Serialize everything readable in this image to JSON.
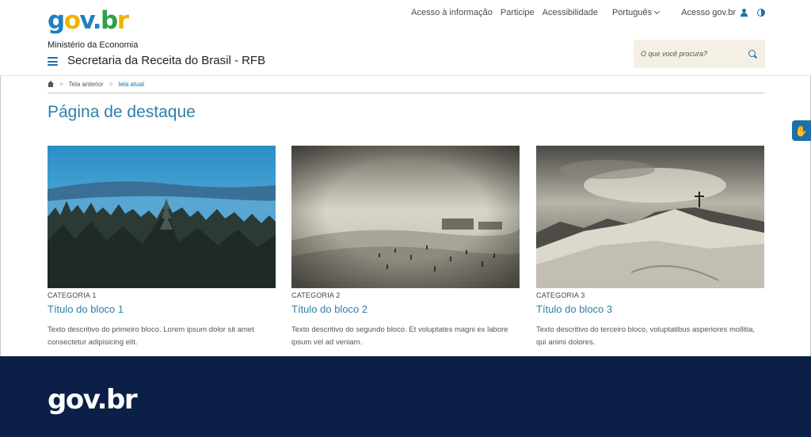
{
  "header": {
    "logo": {
      "g": "g",
      "o": "o",
      "v": "v",
      "dot": ".",
      "b": "b",
      "r": "r"
    },
    "links": [
      "Acesso à informação",
      "Participe",
      "Acessibilidade"
    ],
    "language": "Português",
    "login": "Acesso gov.br",
    "ministry": "Ministério da Economia",
    "site_title": "Secretaria da Receita do Brasil - RFB",
    "search_placeholder": "O que você procura?"
  },
  "breadcrumb": {
    "items": [
      "Tela anterior"
    ],
    "current": "tela atual"
  },
  "page_title": "Página de destaque",
  "cards": [
    {
      "category": "CATEGORIA 1",
      "title": "Título do bloco 1",
      "description": "Texto descritivo do primeiro bloco. Lorem ipsum dolor sit amet consectetur adipisicing elit."
    },
    {
      "category": "CATEGORIA 2",
      "title": "Título do bloco 2",
      "description": "Texto descritivo do segundo bloco. Et voluptates magni ex labore ipsum vel ad veniam."
    },
    {
      "category": "CATEGORIA 3",
      "title": "Título do bloco 3",
      "description": "Texto descritivo do terceiro bloco, voluptatibus asperiores mollitia, qui animi dolores."
    }
  ],
  "footer": {
    "logo": "gov.br"
  },
  "icons": {
    "user": "user-icon",
    "contrast": "contrast-icon",
    "search": "search-icon",
    "menu": "hamburger-icon",
    "home": "home-icon",
    "vlibras": "hand-icon"
  },
  "colors": {
    "brand_blue": "#1f6fa8",
    "title_blue": "#2f7fa8",
    "footer_navy": "#0b1f47",
    "search_bg": "#f5f0e4"
  }
}
